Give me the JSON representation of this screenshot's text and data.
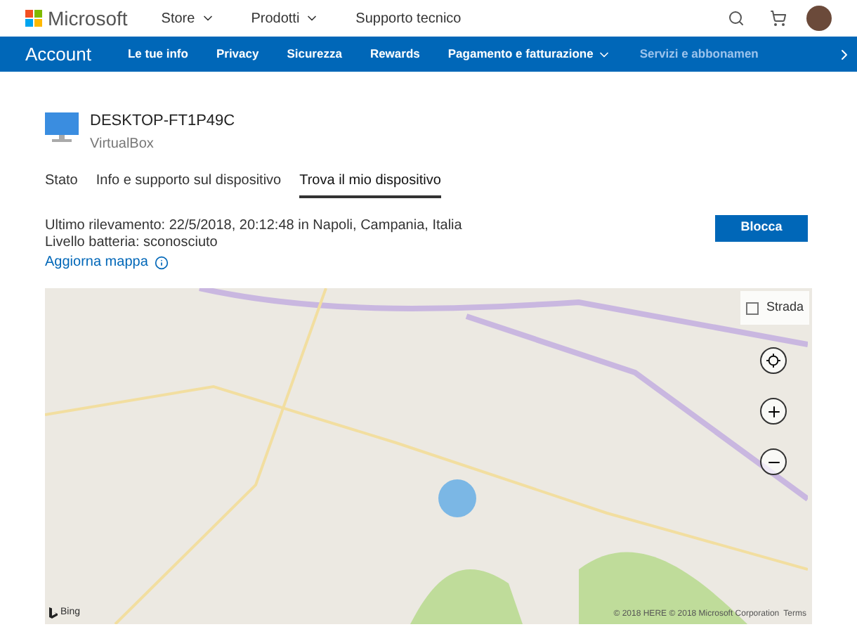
{
  "header": {
    "brand": "Microsoft",
    "menu": [
      {
        "label": "Store",
        "dropdown": true
      },
      {
        "label": "Prodotti",
        "dropdown": true
      },
      {
        "label": "Supporto tecnico",
        "dropdown": false
      }
    ]
  },
  "account_bar": {
    "title": "Account",
    "items": [
      {
        "label": "Le tue info",
        "dropdown": false,
        "faded": false
      },
      {
        "label": "Privacy",
        "dropdown": false,
        "faded": false
      },
      {
        "label": "Sicurezza",
        "dropdown": false,
        "faded": false
      },
      {
        "label": "Rewards",
        "dropdown": false,
        "faded": false
      },
      {
        "label": "Pagamento e fatturazione",
        "dropdown": true,
        "faded": false
      },
      {
        "label": "Servizi e abbonamen",
        "dropdown": false,
        "faded": true
      }
    ]
  },
  "device": {
    "name": "DESKTOP-FT1P49C",
    "model": "VirtualBox"
  },
  "tabs": [
    {
      "label": "Stato",
      "selected": false
    },
    {
      "label": "Info e supporto sul dispositivo",
      "selected": false
    },
    {
      "label": "Trova il mio dispositivo",
      "selected": true
    }
  ],
  "location": {
    "last_seen": "Ultimo rilevamento: 22/5/2018, 20:12:48 in Napoli, Campania, Italia",
    "battery": "Livello batteria: sconosciuto",
    "refresh_link": "Aggiorna mappa",
    "lock_button": "Blocca"
  },
  "map": {
    "view_button": "Strada",
    "logo": "Bing",
    "attribution": "© 2018 HERE © 2018 Microsoft Corporation",
    "terms": "Terms"
  }
}
